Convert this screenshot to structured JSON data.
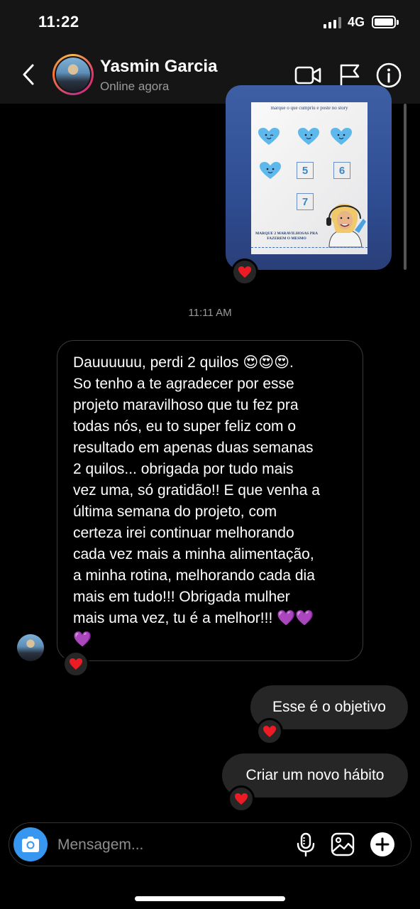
{
  "status_bar": {
    "time": "11:22",
    "network": "4G"
  },
  "header": {
    "name": "Yasmin Garcia",
    "status": "Online agora"
  },
  "image_message": {
    "caption_top": "marque o que cumpriu e poste no story",
    "cells": [
      "5",
      "6",
      "7"
    ],
    "footer": "MARQUE 2 MARAVILHOSAS PRA FAZEREM O MESMO",
    "reaction": "heart"
  },
  "timestamp": "11:11 AM",
  "received_message": {
    "text": "Dauuuuuu, perdi 2 quilos 😍😍😍.\nSo tenho a te agradecer por esse\nprojeto maravilhoso que tu fez pra\ntodas nós, eu to super feliz com o\nresultado em apenas duas semanas\n2 quilos... obrigada por tudo mais\nvez uma, só gratidão!! E que venha a\núltima semana do projeto, com\ncerteza irei continuar melhorando\ncada vez mais a minha alimentação,\na minha rotina, melhorando cada dia\nmais em tudo!!! Obrigada mulher\nmais uma vez, tu é a melhor!!! 💜💜\n💜",
    "reaction": "heart"
  },
  "sent_messages": [
    {
      "text": "Esse é o objetivo",
      "reaction": "heart"
    },
    {
      "text": "Criar um novo hábito",
      "reaction": "heart"
    }
  ],
  "composer": {
    "placeholder": "Mensagem..."
  },
  "colors": {
    "accent": "#3797f0",
    "bubble_sent": "#262626",
    "reaction_heart": "#ed1c24"
  }
}
